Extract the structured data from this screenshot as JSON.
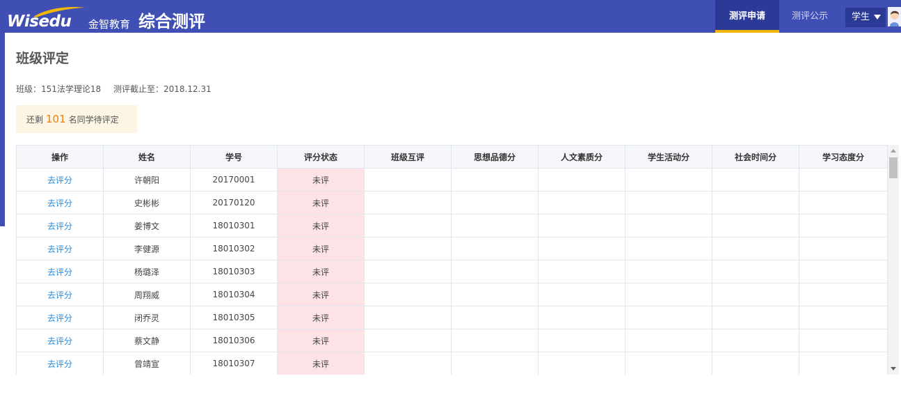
{
  "header": {
    "logo_text": "Wisedu",
    "brand_cn": "金智教育",
    "app_title": "综合测评",
    "tabs": [
      {
        "label": "测评申请",
        "active": true
      },
      {
        "label": "测评公示",
        "active": false
      }
    ],
    "user_role": "学生"
  },
  "page": {
    "title": "班级评定",
    "class_label": "班级：151法学理论18",
    "deadline_label": "测评截止至：2018.12.31",
    "notice_prefix": "还剩",
    "notice_count": "101",
    "notice_suffix": "名同学待评定"
  },
  "table": {
    "columns": [
      "操作",
      "姓名",
      "学号",
      "评分状态",
      "班级互评",
      "思想品德分",
      "人文素质分",
      "学生活动分",
      "社会时间分",
      "学习态度分"
    ],
    "rows": [
      {
        "action": "去评分",
        "name": "许朝阳",
        "id": "20170001",
        "status": "未评"
      },
      {
        "action": "去评分",
        "name": "史彬彬",
        "id": "20170120",
        "status": "未评"
      },
      {
        "action": "去评分",
        "name": "姜博文",
        "id": "18010301",
        "status": "未评"
      },
      {
        "action": "去评分",
        "name": "李健源",
        "id": "18010302",
        "status": "未评"
      },
      {
        "action": "去评分",
        "name": "杨璐泽",
        "id": "18010303",
        "status": "未评"
      },
      {
        "action": "去评分",
        "name": "周翔威",
        "id": "18010304",
        "status": "未评"
      },
      {
        "action": "去评分",
        "name": "闭乔灵",
        "id": "18010305",
        "status": "未评"
      },
      {
        "action": "去评分",
        "name": "蔡文静",
        "id": "18010306",
        "status": "未评"
      },
      {
        "action": "去评分",
        "name": "曾靖宣",
        "id": "18010307",
        "status": "未评"
      }
    ]
  },
  "colors": {
    "header_bg": "#3f4fb4",
    "active_tab_bg": "#2b3a97",
    "active_tab_underline": "#f2b705",
    "link": "#2a8ad8",
    "status_bg": "#fde3e6",
    "notice_bg": "#fdf5e3",
    "notice_count": "#f07f0b"
  },
  "icons": {
    "dropdown": "caret-down-icon",
    "avatar": "user-avatar-icon"
  }
}
